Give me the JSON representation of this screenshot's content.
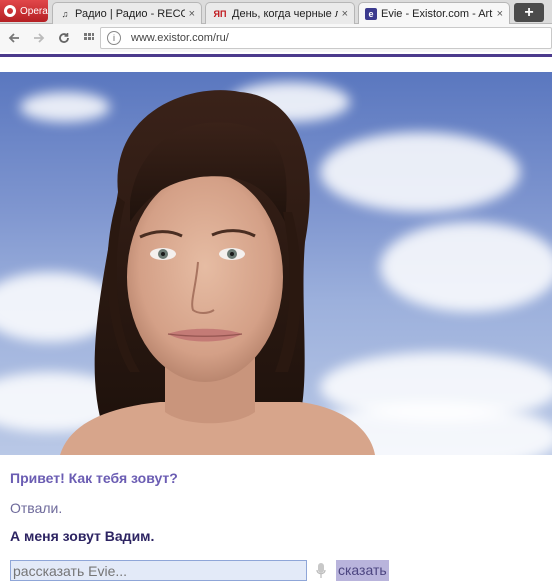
{
  "browser": {
    "opera_label": "Opera",
    "tabs": [
      {
        "favicon": "♫",
        "title": "Радио | Радио - RECORD",
        "active": false
      },
      {
        "favicon": "ЯП",
        "title": "День, когда черные люди",
        "active": false
      },
      {
        "favicon": "e",
        "title": "Evie - Existor.com - Artific",
        "active": true
      }
    ],
    "close_glyph": "×",
    "new_tab_glyph": "+",
    "url": "www.existor.com/ru/"
  },
  "chat": {
    "evie_message": "Привет! Как тебя зовут?",
    "evie_previous": "Отвали.",
    "user_message": "А меня зовут Вадим.",
    "input_placeholder": "рассказать Evie...",
    "say_label": "сказать"
  },
  "colors": {
    "accent": "#4b3a8c",
    "evie_text": "#6b5db3",
    "user_text": "#2d2462"
  }
}
